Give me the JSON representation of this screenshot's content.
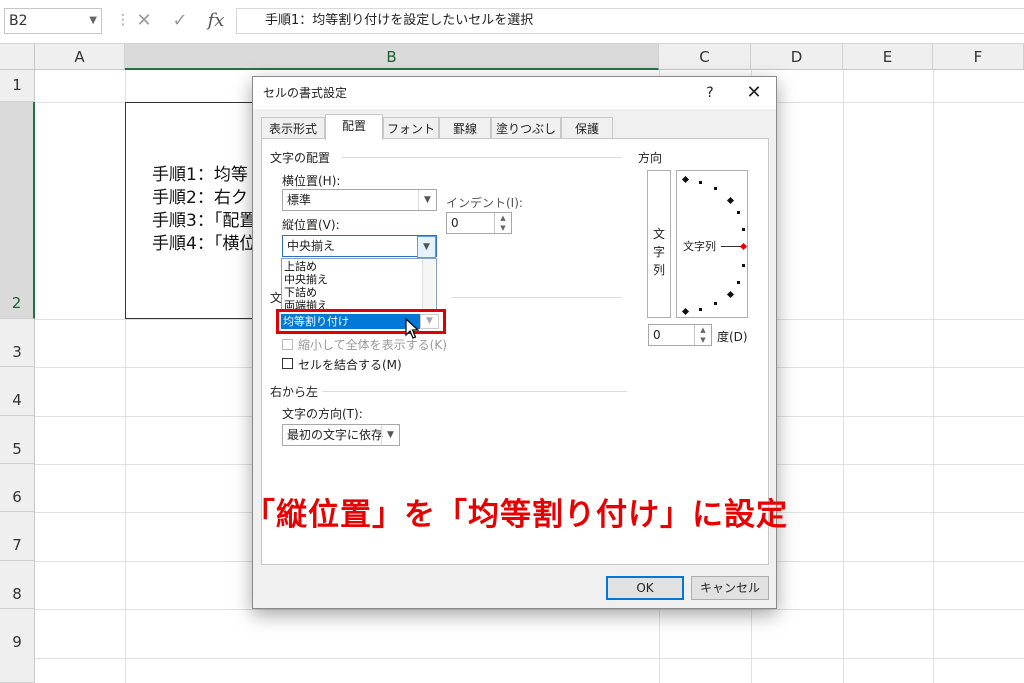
{
  "formula_bar": {
    "name_box": "B2",
    "separator": "⋮",
    "cancel": "✕",
    "enter": "✓",
    "fx": "fx",
    "content": "手順1：均等割り付けを設定したいセルを選択"
  },
  "columns": [
    "A",
    "B",
    "C",
    "D",
    "E",
    "F"
  ],
  "rows": [
    "1",
    "2",
    "3",
    "4",
    "5",
    "6",
    "7",
    "8",
    "9"
  ],
  "cell_b2": "手順1：均等\n手順2：右ク\n手順3：「配置\n手順4：「横位",
  "dialog": {
    "title": "セルの書式設定",
    "help": "?",
    "close": "✕",
    "tabs": [
      "表示形式",
      "配置",
      "フォント",
      "罫線",
      "塗りつぶし",
      "保護"
    ],
    "active_tab": "配置",
    "text_alignment_group": "文字の配置",
    "horizontal_label": "横位置(H):",
    "horizontal_value": "標準",
    "indent_label": "インデント(I):",
    "indent_value": "0",
    "vertical_label": "縦位置(V):",
    "vertical_value": "中央揃え",
    "vertical_options": [
      "上詰め",
      "中央揃え",
      "下詰め",
      "両端揃え",
      "均等割り付け"
    ],
    "selected_option": "均等割り付け",
    "text_control_group_fragment": "文",
    "shrink_label": "縮小して全体を表示する(K)",
    "merge_label": "セルを結合する(M)",
    "rtl_group": "右から左",
    "direction_label": "文字の方向(T):",
    "direction_value": "最初の文字に依存",
    "orientation_group": "方向",
    "vertical_text": "文\n字\n列",
    "orientation_text": "文字列",
    "degree_value": "0",
    "degree_label": "度(D)",
    "ok_label": "OK",
    "cancel_label": "キャンセル"
  },
  "annotation": "「縦位置」を「均等割り付け」に設定",
  "colors": {
    "excel_green": "#217346",
    "annotation_red": "#e60000",
    "selection_blue": "#0078d7"
  }
}
